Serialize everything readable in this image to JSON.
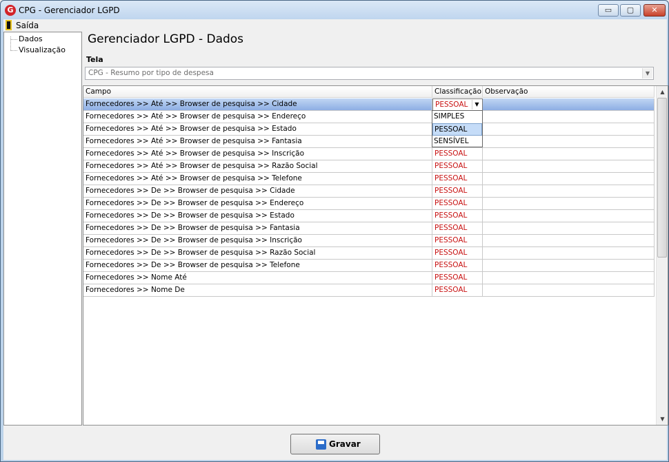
{
  "window": {
    "title": "CPG - Gerenciador LGPD",
    "icon_letter": "G",
    "buttons": {
      "minimize": "▭",
      "maximize": "▢",
      "close": "✕"
    }
  },
  "menu": {
    "saida": "Saída"
  },
  "tree": {
    "items": [
      {
        "label": "Dados"
      },
      {
        "label": "Visualização"
      }
    ]
  },
  "page": {
    "title": "Gerenciador LGPD - Dados"
  },
  "tela": {
    "label": "Tela",
    "selected": "CPG - Resumo por tipo de despesa"
  },
  "grid": {
    "headers": {
      "campo": "Campo",
      "classificacao": "Classificação",
      "observacao": "Observação"
    },
    "rows": [
      {
        "campo": "Fornecedores >> Até >> Browser de pesquisa >> Cidade",
        "classificacao": "PESSOAL",
        "observacao": ""
      },
      {
        "campo": "Fornecedores >> Até >> Browser de pesquisa >> Endereço",
        "classificacao": "",
        "observacao": ""
      },
      {
        "campo": "Fornecedores >> Até >> Browser de pesquisa >> Estado",
        "classificacao": "",
        "observacao": ""
      },
      {
        "campo": "Fornecedores >> Até >> Browser de pesquisa >> Fantasia",
        "classificacao": "",
        "observacao": ""
      },
      {
        "campo": "Fornecedores >> Até >> Browser de pesquisa >> Inscrição",
        "classificacao": "PESSOAL",
        "observacao": ""
      },
      {
        "campo": "Fornecedores >> Até >> Browser de pesquisa >> Razão Social",
        "classificacao": "PESSOAL",
        "observacao": ""
      },
      {
        "campo": "Fornecedores >> Até >> Browser de pesquisa >> Telefone",
        "classificacao": "PESSOAL",
        "observacao": ""
      },
      {
        "campo": "Fornecedores >> De >> Browser de pesquisa >> Cidade",
        "classificacao": "PESSOAL",
        "observacao": ""
      },
      {
        "campo": "Fornecedores >> De >> Browser de pesquisa >> Endereço",
        "classificacao": "PESSOAL",
        "observacao": ""
      },
      {
        "campo": "Fornecedores >> De >> Browser de pesquisa >> Estado",
        "classificacao": "PESSOAL",
        "observacao": ""
      },
      {
        "campo": "Fornecedores >> De >> Browser de pesquisa >> Fantasia",
        "classificacao": "PESSOAL",
        "observacao": ""
      },
      {
        "campo": "Fornecedores >> De >> Browser de pesquisa >> Inscrição",
        "classificacao": "PESSOAL",
        "observacao": ""
      },
      {
        "campo": "Fornecedores >> De >> Browser de pesquisa >> Razão Social",
        "classificacao": "PESSOAL",
        "observacao": ""
      },
      {
        "campo": "Fornecedores >> De >> Browser de pesquisa >> Telefone",
        "classificacao": "PESSOAL",
        "observacao": ""
      },
      {
        "campo": "Fornecedores >> Nome Até",
        "classificacao": "PESSOAL",
        "observacao": ""
      },
      {
        "campo": "Fornecedores >> Nome De",
        "classificacao": "PESSOAL",
        "observacao": ""
      }
    ],
    "dropdown_options": [
      "SIMPLES",
      "PESSOAL",
      "SENSÍVEL"
    ],
    "dropdown_highlighted": "PESSOAL"
  },
  "scrollbar": {
    "up_arrow": "▲",
    "down_arrow": "▼",
    "arrow_down": "▼"
  },
  "actions": {
    "gravar": "Gravar"
  },
  "colors": {
    "classificacao_text": "#c81010",
    "selection": "#8daee4"
  }
}
